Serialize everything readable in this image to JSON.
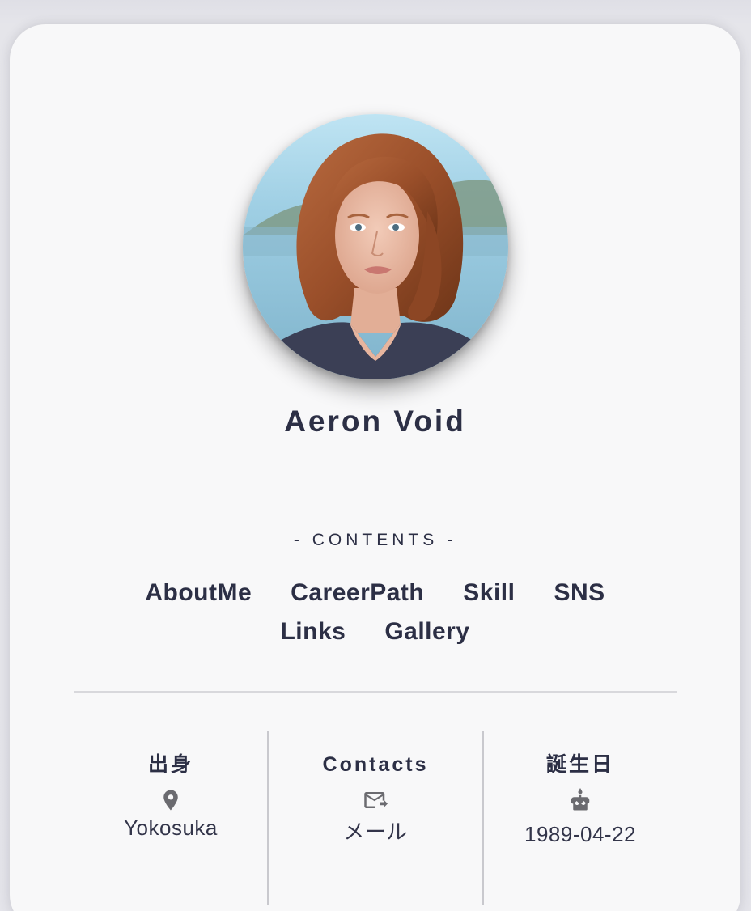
{
  "profile": {
    "name": "Aeron Void",
    "avatar_alt": "profile-photo"
  },
  "contents": {
    "heading": "- CONTENTS -",
    "links": [
      "AboutMe",
      "CareerPath",
      "Skill",
      "SNS",
      "Links",
      "Gallery"
    ]
  },
  "info": {
    "birthplace": {
      "label": "出身",
      "icon": "location-pin-icon",
      "value": "Yokosuka"
    },
    "contacts": {
      "label": "Contacts",
      "icon": "email-forward-icon",
      "value": "メール"
    },
    "birthday": {
      "label": "誕生日",
      "icon": "cake-icon",
      "value": "1989-04-22"
    }
  },
  "colors": {
    "text": "#2c2f45",
    "card": "#f8f8f9",
    "background": "#e4e4ea",
    "icon": "#6b6b70"
  }
}
